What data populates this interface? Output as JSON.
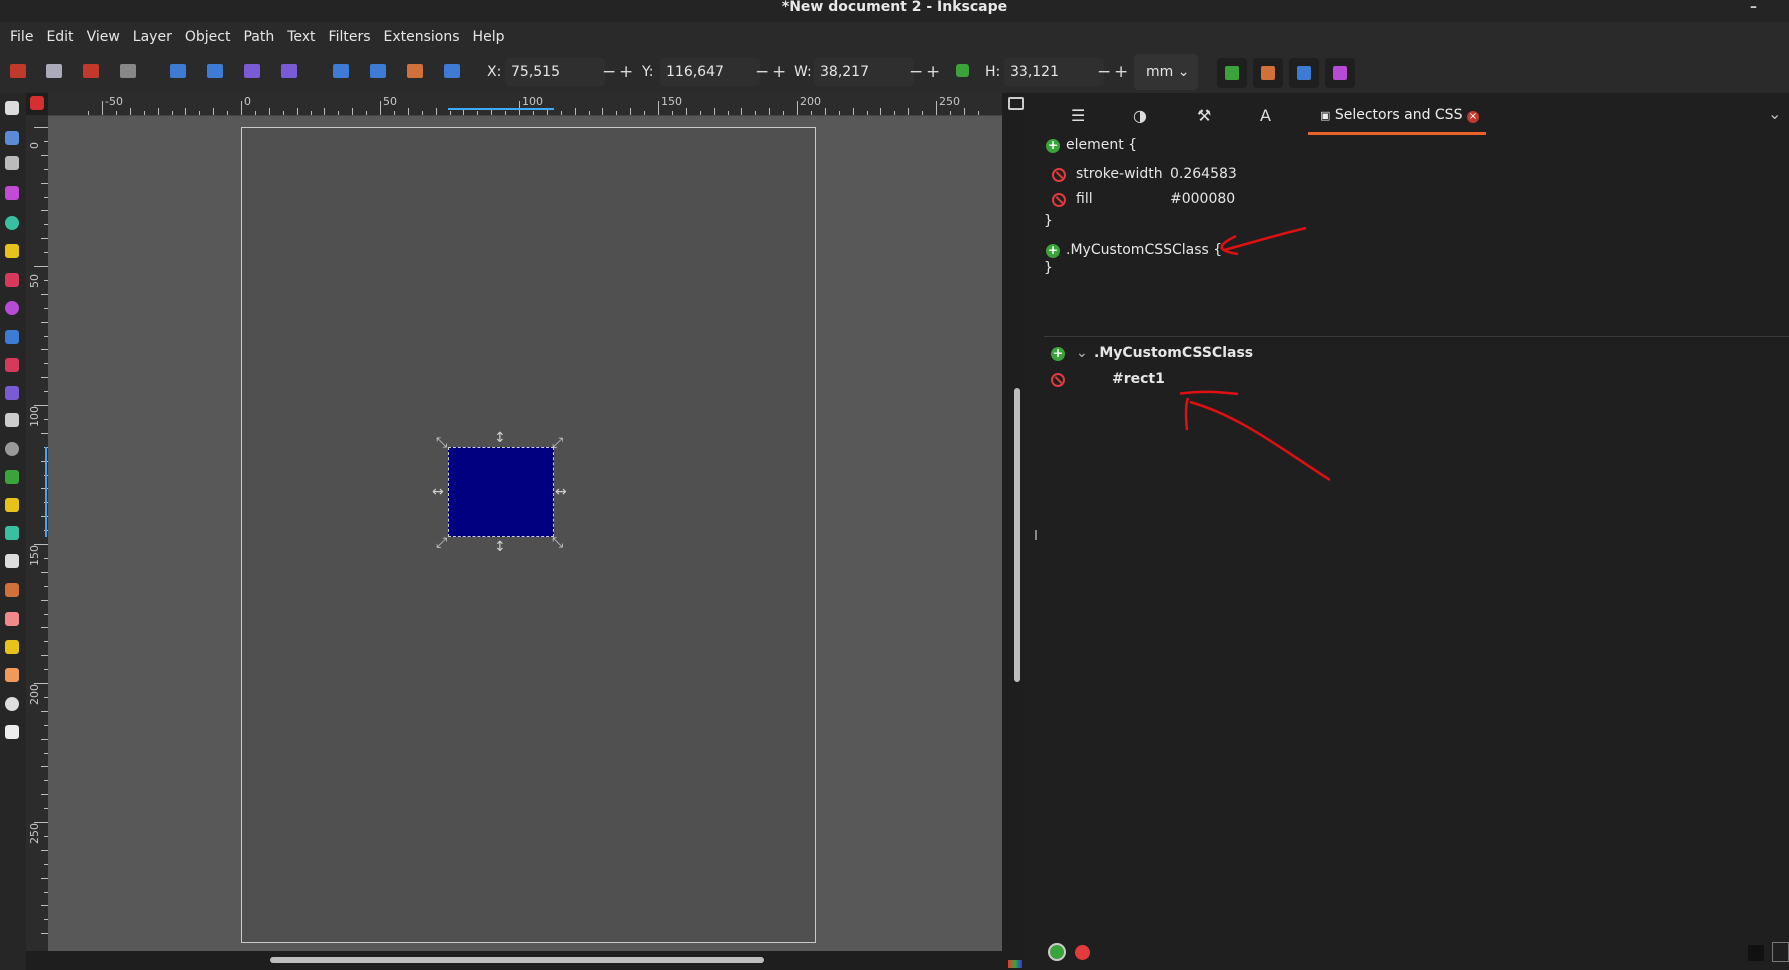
{
  "window": {
    "title": "*New document 2 - Inkscape",
    "minimize_glyph": "–"
  },
  "menubar": [
    "File",
    "Edit",
    "View",
    "Layer",
    "Object",
    "Path",
    "Text",
    "Filters",
    "Extensions",
    "Help"
  ],
  "toolbar": {
    "x_label": "X:",
    "x_value": "75,515",
    "y_label": "Y:",
    "y_value": "116,647",
    "w_label": "W:",
    "w_value": "38,217",
    "h_label": "H:",
    "h_value": "33,121",
    "minus": "−",
    "plus": "+",
    "units": "mm"
  },
  "ruler": {
    "h_labels": [
      "-50",
      "0",
      "50",
      "100",
      "150",
      "200",
      "250"
    ],
    "v_labels": [
      "0",
      "50",
      "100",
      "150",
      "200",
      "250"
    ]
  },
  "dock": {
    "active_tab": "Selectors and CSS",
    "css_block_1": {
      "selector": "element {",
      "props": [
        {
          "name": "stroke-width",
          "value": "0.264583"
        },
        {
          "name": "fill",
          "value": "#000080"
        }
      ],
      "close": "}"
    },
    "css_block_2": {
      "selector": ".MyCustomCSSClass {",
      "close": "}"
    },
    "tree": {
      "class": ".MyCustomCSSClass",
      "child": "#rect1"
    }
  },
  "colors": {
    "rect_fill": "#000080",
    "annotation": "#e01010",
    "accent": "#e8622a"
  }
}
